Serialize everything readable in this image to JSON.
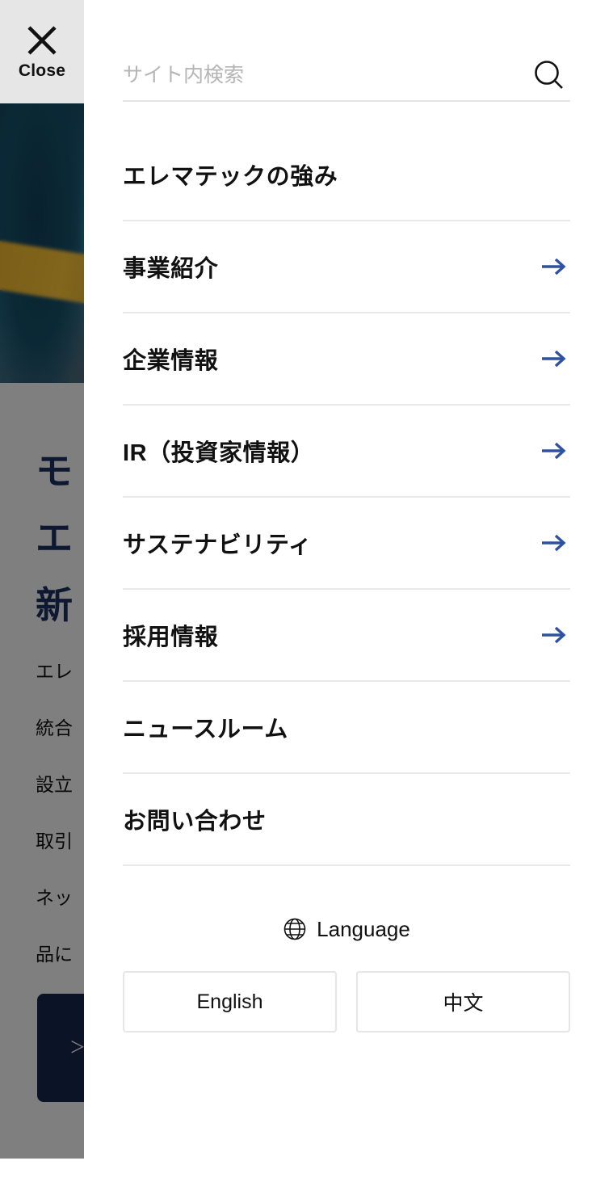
{
  "close_panel": {
    "label": "Close",
    "icon": "close-icon"
  },
  "search": {
    "placeholder": "サイト内検索",
    "value": "",
    "icon": "search-icon"
  },
  "nav": {
    "items": [
      {
        "label": "エレマテックの強み",
        "has_arrow": false
      },
      {
        "label": "事業紹介",
        "has_arrow": true
      },
      {
        "label": "企業情報",
        "has_arrow": true
      },
      {
        "label": "IR（投資家情報）",
        "has_arrow": true
      },
      {
        "label": "サステナビリティ",
        "has_arrow": true
      },
      {
        "label": "採用情報",
        "has_arrow": true
      },
      {
        "label": "ニュースルーム",
        "has_arrow": false
      },
      {
        "label": "お問い合わせ",
        "has_arrow": false
      }
    ],
    "arrow_icon": "arrow-right-icon",
    "arrow_color": "#2f52a0"
  },
  "language": {
    "heading": "Language",
    "icon": "globe-icon",
    "options": [
      {
        "label": "English"
      },
      {
        "label": "中文"
      }
    ]
  },
  "background_page": {
    "heading": "モ\nエ\n新",
    "paragraph": "エレ\n統合\n設立\n取引\nネッ\n品に\nす。",
    "cta_label": "＞",
    "heading_color": "#1c3263",
    "cta_color": "#17264f"
  },
  "theme": {
    "panel_bg": "#ffffff",
    "close_panel_bg": "#e6e6e6",
    "divider": "#e9e9e9",
    "placeholder": "#b5b5b5",
    "overlay": "rgba(0,0,0,0.5)"
  }
}
